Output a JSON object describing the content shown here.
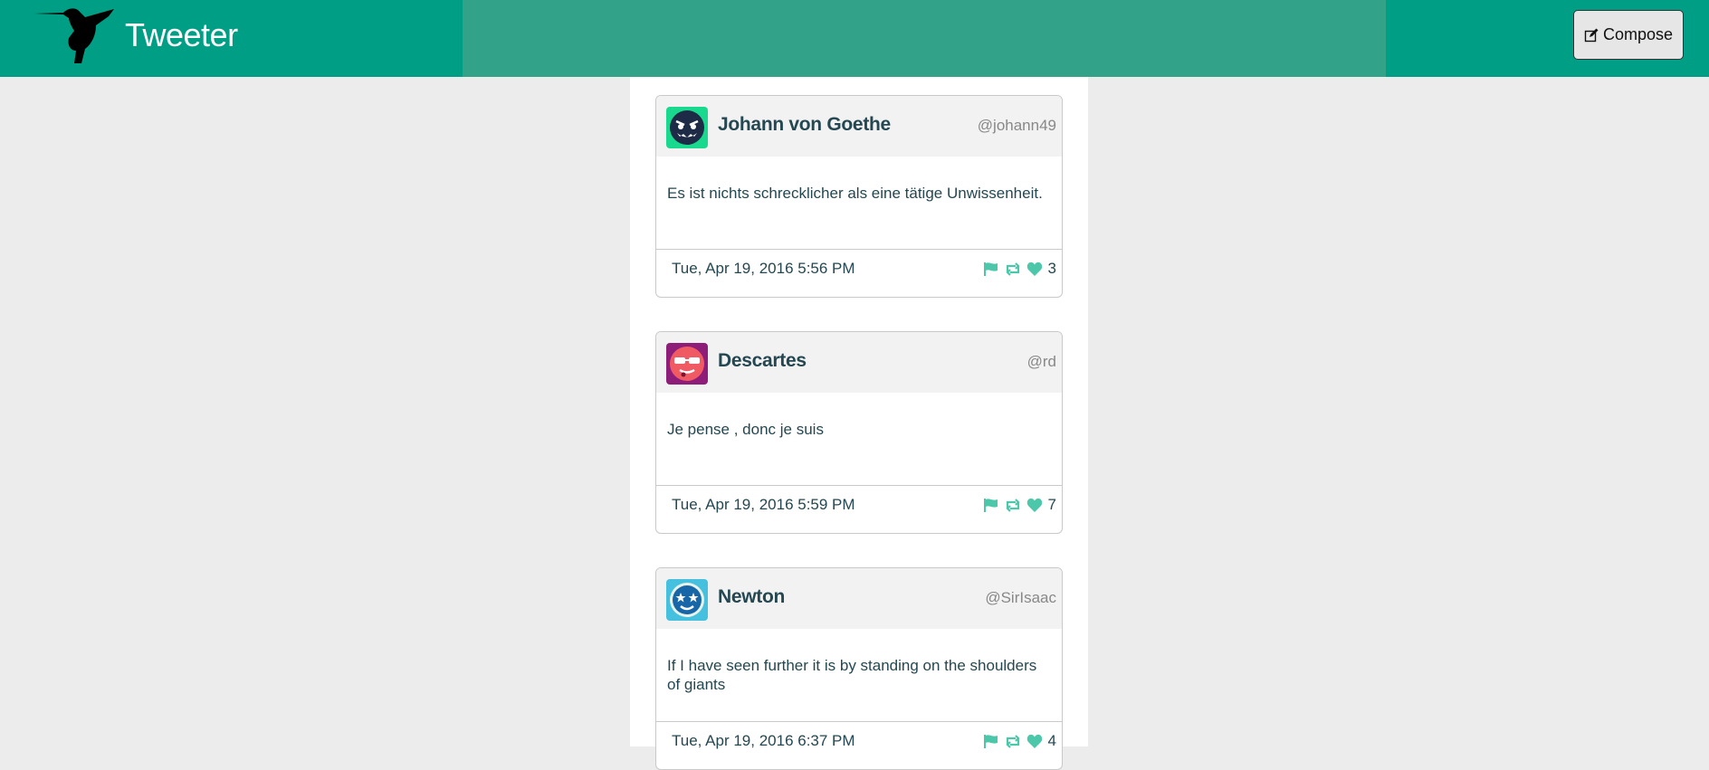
{
  "app": {
    "brand": "Tweeter",
    "compose_label": "Compose",
    "accent": "#009e84",
    "action_color": "#4cc7a9"
  },
  "tweets": [
    {
      "name": "Johann von Goethe",
      "handle": "@johann49",
      "text": "Es ist nichts schrecklicher als eine tätige Unwissenheit.",
      "date": "Tue, Apr 19, 2016 5:56 PM",
      "likes": "3",
      "avatar": "monster-face-avatar"
    },
    {
      "name": "Descartes",
      "handle": "@rd",
      "text": "Je pense , donc je suis",
      "date": "Tue, Apr 19, 2016 5:59 PM",
      "likes": "7",
      "avatar": "sunglasses-face-avatar"
    },
    {
      "name": "Newton",
      "handle": "@SirIsaac",
      "text": "If I have seen further it is by standing on the shoulders of giants",
      "date": "Tue, Apr 19, 2016 6:37 PM",
      "likes": "4",
      "avatar": "star-eyes-face-avatar"
    }
  ]
}
